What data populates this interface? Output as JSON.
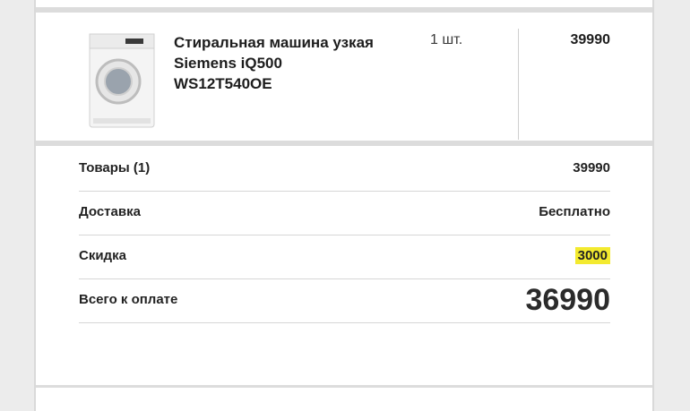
{
  "product": {
    "name": "Стиральная машина узкая Siemens iQ500 WS12T540OE",
    "quantity": "1 шт.",
    "price": "39990"
  },
  "summary": {
    "rows": [
      {
        "label": "Товары (1)",
        "value": "39990"
      },
      {
        "label": "Доставка",
        "value": "Бесплатно"
      },
      {
        "label": "Скидка",
        "value": "3000"
      },
      {
        "label": "Всего к оплате",
        "value": "36990"
      }
    ]
  },
  "colors": {
    "highlight": "#f3ea2f",
    "page_bg": "#ececec"
  }
}
